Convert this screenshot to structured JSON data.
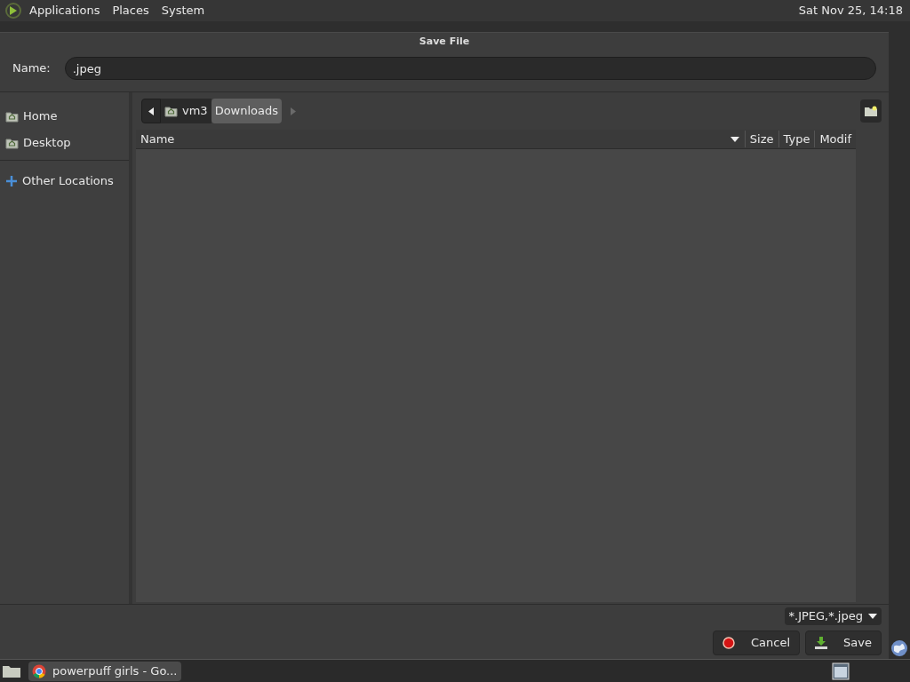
{
  "top_panel": {
    "menus": [
      "Applications",
      "Places",
      "System"
    ],
    "clock": "Sat Nov 25, 14:18"
  },
  "dialog": {
    "title": "Save File",
    "name_label": "Name:",
    "name_value": ".jpeg",
    "sidebar": {
      "items": [
        {
          "label": "Home",
          "kind": "folder",
          "selected": false
        },
        {
          "label": "Desktop",
          "kind": "folder",
          "selected": false
        },
        {
          "label": "Other Locations",
          "kind": "network",
          "selected": false
        }
      ]
    },
    "path_bar": {
      "segments": [
        {
          "label": "vm3",
          "selected": false
        },
        {
          "label": "Downloads",
          "selected": true
        }
      ]
    },
    "columns": [
      "Name",
      "Size",
      "Type",
      "Modif"
    ],
    "filter": "*.JPEG,*.jpeg",
    "buttons": [
      {
        "label": "Cancel",
        "kind": "cancel"
      },
      {
        "label": "Save",
        "kind": "save"
      }
    ]
  },
  "taskbar": {
    "tasks": [
      {
        "label": "powerpuff girls - Go...",
        "selected": false
      }
    ]
  }
}
